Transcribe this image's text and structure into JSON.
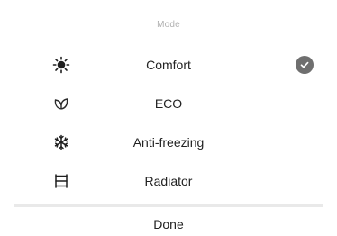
{
  "sheet": {
    "title": "Mode",
    "modes": [
      {
        "label": "Comfort",
        "icon": "sun-icon",
        "selected": true
      },
      {
        "label": "ECO",
        "icon": "leaf-icon",
        "selected": false
      },
      {
        "label": "Anti-freezing",
        "icon": "snowflake-icon",
        "selected": false
      },
      {
        "label": "Radiator",
        "icon": "radiator-icon",
        "selected": false
      }
    ],
    "done_label": "Done"
  },
  "colors": {
    "title": "#b0b0b0",
    "text": "#222222",
    "check_bg": "#6f6f6f",
    "divider": "#e9e9e9"
  }
}
